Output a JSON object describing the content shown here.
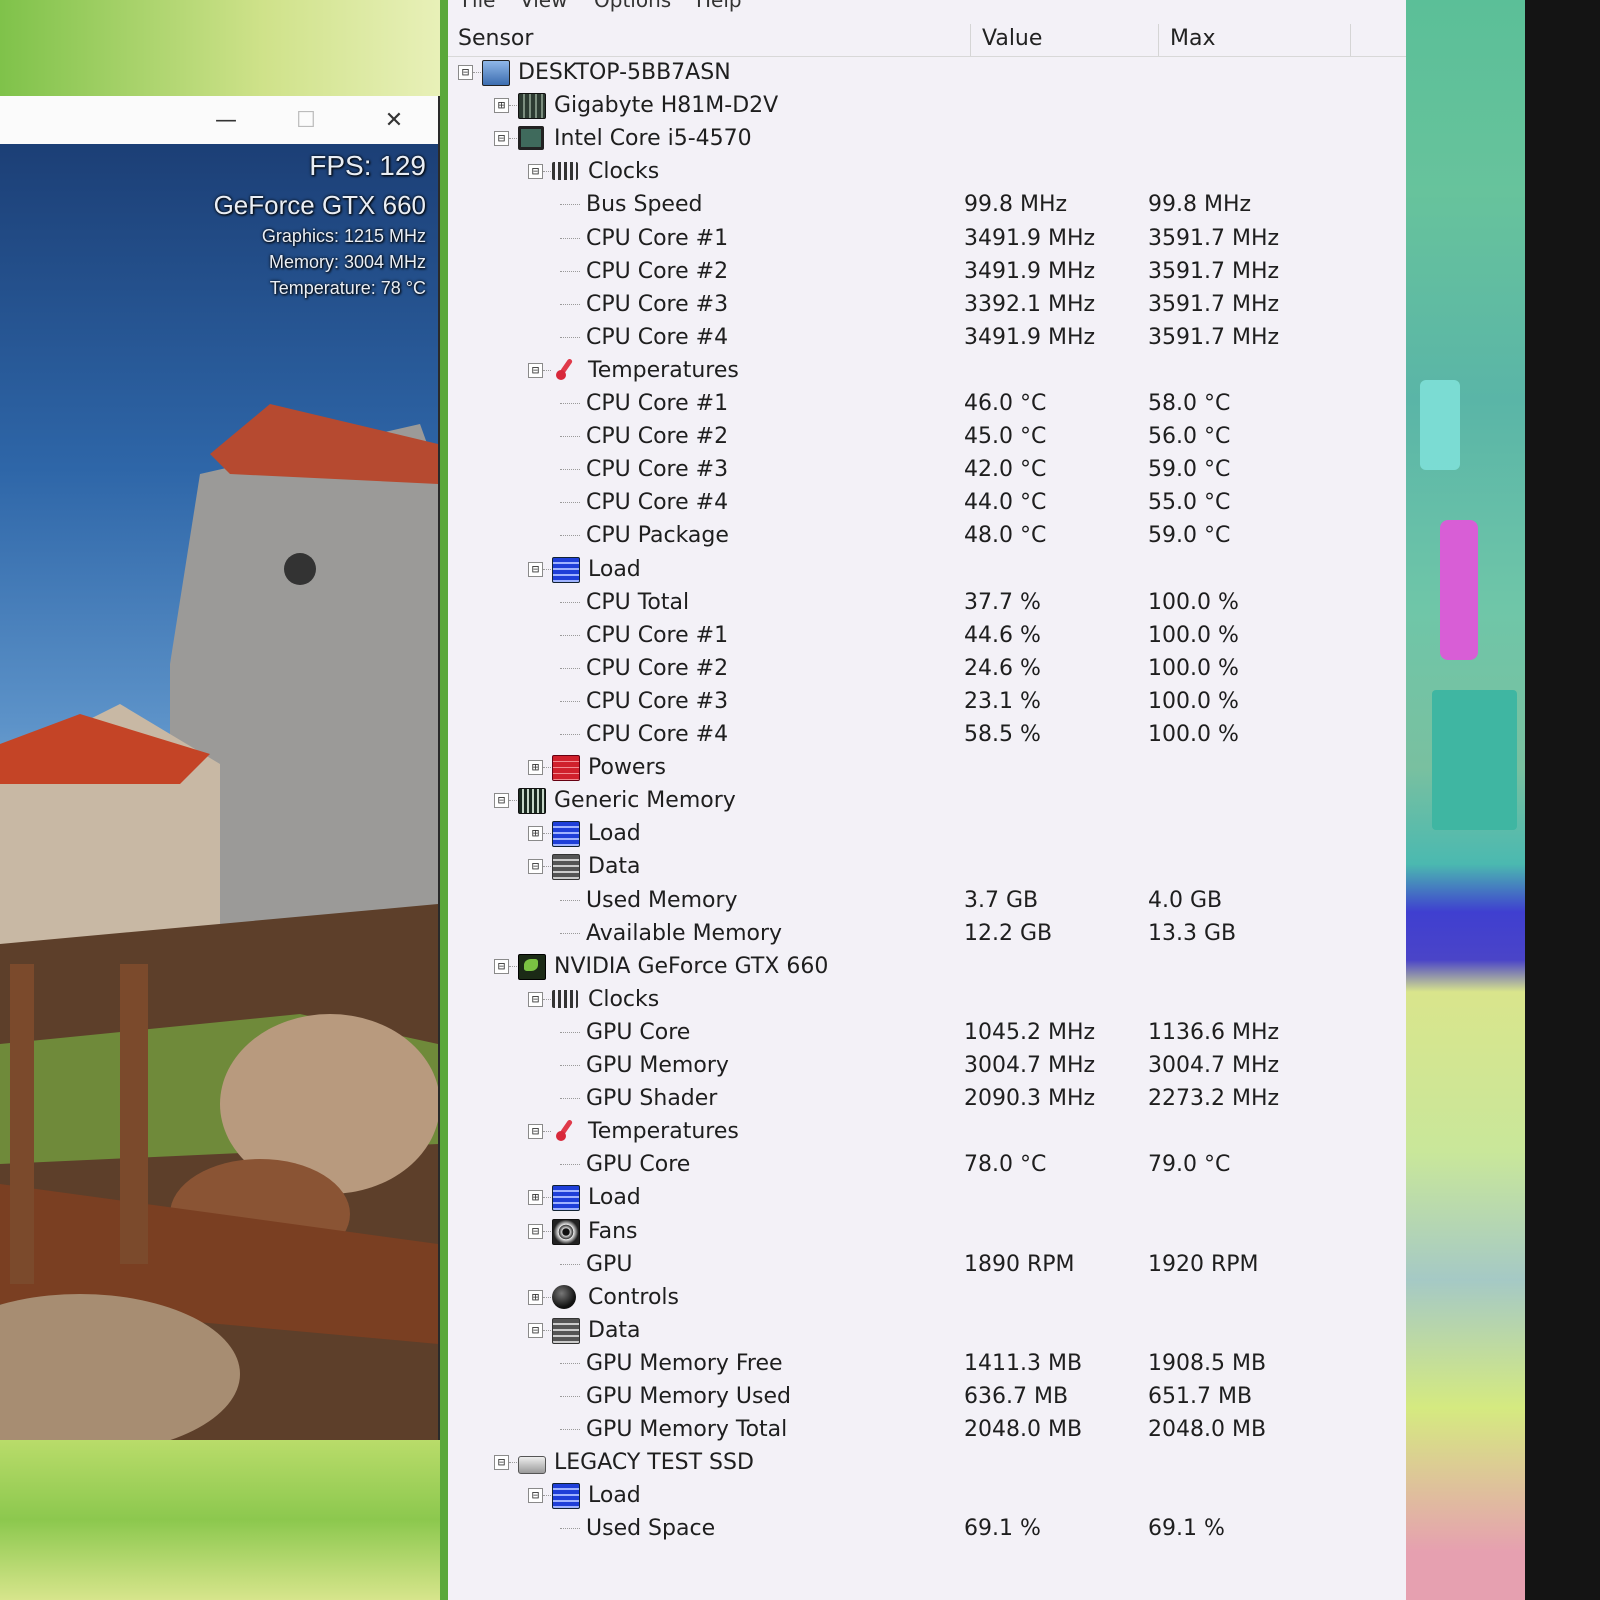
{
  "game": {
    "fps": "FPS: 129",
    "gpu_name": "GeForce GTX 660",
    "graphics": "Graphics: 1215 MHz",
    "memory": "Memory: 3004 MHz",
    "temperature": "Temperature: 78 °C",
    "minimize": "—",
    "maximize": "☐",
    "close": "✕"
  },
  "menu": [
    "File",
    "View",
    "Options",
    "Help"
  ],
  "columns": {
    "sensor": "Sensor",
    "value": "Value",
    "max": "Max"
  },
  "rows": [
    {
      "label": "DESKTOP-5BB7ASN",
      "value": "",
      "max": "",
      "level": 0,
      "exp": "⊟",
      "icon": "computer"
    },
    {
      "label": "Gigabyte H81M-D2V",
      "value": "",
      "max": "",
      "level": 1,
      "exp": "⊞",
      "icon": "board"
    },
    {
      "label": "Intel Core i5-4570",
      "value": "",
      "max": "",
      "level": 1,
      "exp": "⊟",
      "icon": "cpu"
    },
    {
      "label": "Clocks",
      "value": "",
      "max": "",
      "level": 2,
      "exp": "⊟",
      "icon": "clock"
    },
    {
      "label": "Bus Speed",
      "value": "99.8 MHz",
      "max": "99.8 MHz",
      "level": 3
    },
    {
      "label": "CPU Core #1",
      "value": "3491.9 MHz",
      "max": "3591.7 MHz",
      "level": 3
    },
    {
      "label": "CPU Core #2",
      "value": "3491.9 MHz",
      "max": "3591.7 MHz",
      "level": 3
    },
    {
      "label": "CPU Core #3",
      "value": "3392.1 MHz",
      "max": "3591.7 MHz",
      "level": 3
    },
    {
      "label": "CPU Core #4",
      "value": "3491.9 MHz",
      "max": "3591.7 MHz",
      "level": 3
    },
    {
      "label": "Temperatures",
      "value": "",
      "max": "",
      "level": 2,
      "exp": "⊟",
      "icon": "temp"
    },
    {
      "label": "CPU Core #1",
      "value": "46.0 °C",
      "max": "58.0 °C",
      "level": 3
    },
    {
      "label": "CPU Core #2",
      "value": "45.0 °C",
      "max": "56.0 °C",
      "level": 3
    },
    {
      "label": "CPU Core #3",
      "value": "42.0 °C",
      "max": "59.0 °C",
      "level": 3
    },
    {
      "label": "CPU Core #4",
      "value": "44.0 °C",
      "max": "55.0 °C",
      "level": 3
    },
    {
      "label": "CPU Package",
      "value": "48.0 °C",
      "max": "59.0 °C",
      "level": 3
    },
    {
      "label": "Load",
      "value": "",
      "max": "",
      "level": 2,
      "exp": "⊟",
      "icon": "load"
    },
    {
      "label": "CPU Total",
      "value": "37.7 %",
      "max": "100.0 %",
      "level": 3
    },
    {
      "label": "CPU Core #1",
      "value": "44.6 %",
      "max": "100.0 %",
      "level": 3
    },
    {
      "label": "CPU Core #2",
      "value": "24.6 %",
      "max": "100.0 %",
      "level": 3
    },
    {
      "label": "CPU Core #3",
      "value": "23.1 %",
      "max": "100.0 %",
      "level": 3
    },
    {
      "label": "CPU Core #4",
      "value": "58.5 %",
      "max": "100.0 %",
      "level": 3
    },
    {
      "label": "Powers",
      "value": "",
      "max": "",
      "level": 2,
      "exp": "⊞",
      "icon": "power"
    },
    {
      "label": "Generic Memory",
      "value": "",
      "max": "",
      "level": 1,
      "exp": "⊟",
      "icon": "ram"
    },
    {
      "label": "Load",
      "value": "",
      "max": "",
      "level": 2,
      "exp": "⊞",
      "icon": "load"
    },
    {
      "label": "Data",
      "value": "",
      "max": "",
      "level": 2,
      "exp": "⊟",
      "icon": "data"
    },
    {
      "label": "Used Memory",
      "value": "3.7 GB",
      "max": "4.0 GB",
      "level": 3
    },
    {
      "label": "Available Memory",
      "value": "12.2 GB",
      "max": "13.3 GB",
      "level": 3
    },
    {
      "label": "NVIDIA GeForce GTX 660",
      "value": "",
      "max": "",
      "level": 1,
      "exp": "⊟",
      "icon": "nvidia"
    },
    {
      "label": "Clocks",
      "value": "",
      "max": "",
      "level": 2,
      "exp": "⊟",
      "icon": "clock"
    },
    {
      "label": "GPU Core",
      "value": "1045.2 MHz",
      "max": "1136.6 MHz",
      "level": 3
    },
    {
      "label": "GPU Memory",
      "value": "3004.7 MHz",
      "max": "3004.7 MHz",
      "level": 3
    },
    {
      "label": "GPU Shader",
      "value": "2090.3 MHz",
      "max": "2273.2 MHz",
      "level": 3
    },
    {
      "label": "Temperatures",
      "value": "",
      "max": "",
      "level": 2,
      "exp": "⊟",
      "icon": "temp"
    },
    {
      "label": "GPU Core",
      "value": "78.0 °C",
      "max": "79.0 °C",
      "level": 3
    },
    {
      "label": "Load",
      "value": "",
      "max": "",
      "level": 2,
      "exp": "⊞",
      "icon": "load"
    },
    {
      "label": "Fans",
      "value": "",
      "max": "",
      "level": 2,
      "exp": "⊟",
      "icon": "fan"
    },
    {
      "label": "GPU",
      "value": "1890 RPM",
      "max": "1920 RPM",
      "level": 3
    },
    {
      "label": "Controls",
      "value": "",
      "max": "",
      "level": 2,
      "exp": "⊞",
      "icon": "control"
    },
    {
      "label": "Data",
      "value": "",
      "max": "",
      "level": 2,
      "exp": "⊟",
      "icon": "data"
    },
    {
      "label": "GPU Memory Free",
      "value": "1411.3 MB",
      "max": "1908.5 MB",
      "level": 3
    },
    {
      "label": "GPU Memory Used",
      "value": "636.7 MB",
      "max": "651.7 MB",
      "level": 3
    },
    {
      "label": "GPU Memory Total",
      "value": "2048.0 MB",
      "max": "2048.0 MB",
      "level": 3
    },
    {
      "label": "LEGACY TEST SSD",
      "value": "",
      "max": "",
      "level": 1,
      "exp": "⊟",
      "icon": "disk"
    },
    {
      "label": "Load",
      "value": "",
      "max": "",
      "level": 2,
      "exp": "⊟",
      "icon": "load"
    },
    {
      "label": "Used Space",
      "value": "69.1 %",
      "max": "69.1 %",
      "level": 3
    }
  ]
}
